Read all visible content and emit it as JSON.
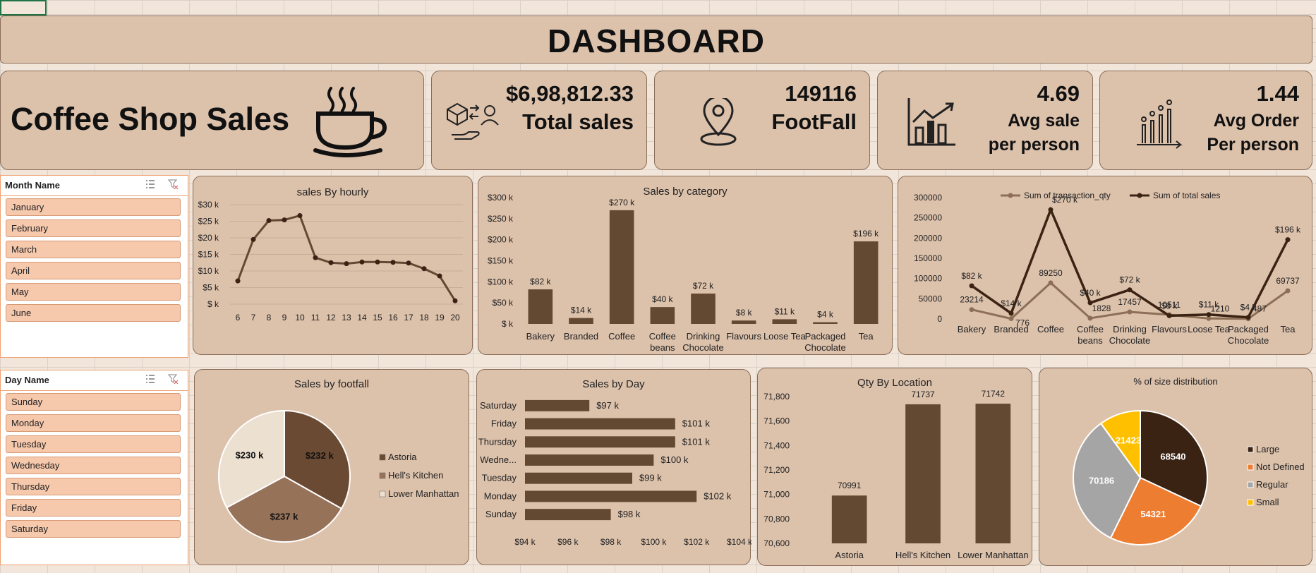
{
  "dashboard_title": "DASHBOARD",
  "kpis": {
    "shop_title": "Coffee Shop Sales",
    "total_sales_value": "$6,98,812.33",
    "total_sales_label": "Total sales",
    "footfall_value": "149116",
    "footfall_label": "FootFall",
    "avg_sale_value": "4.69",
    "avg_sale_label_1": "Avg sale",
    "avg_sale_label_2": "per person",
    "avg_order_value": "1.44",
    "avg_order_label_1": "Avg Order",
    "avg_order_label_2": "Per person"
  },
  "slicers": {
    "month": {
      "header": "Month Name",
      "items": [
        "January",
        "February",
        "March",
        "April",
        "May",
        "June"
      ]
    },
    "day": {
      "header": "Day Name",
      "items": [
        "Sunday",
        "Monday",
        "Tuesday",
        "Wednesday",
        "Thursday",
        "Friday",
        "Saturday"
      ]
    }
  },
  "colors": {
    "bar": "#634832",
    "line": "#634832",
    "panel": "#dcc1ab",
    "dark_line": "#3b2314",
    "light_line": "#8d6e57"
  },
  "chart_data": [
    {
      "id": "hourly",
      "type": "line",
      "title": "sales By hourly",
      "x": [
        6,
        7,
        8,
        9,
        10,
        11,
        12,
        13,
        14,
        15,
        16,
        17,
        18,
        19,
        20
      ],
      "values": [
        7000,
        19500,
        25200,
        25400,
        26700,
        14000,
        12500,
        12200,
        12700,
        12700,
        12600,
        12400,
        10700,
        8500,
        1000
      ],
      "yticks": [
        "$30 k",
        "$25 k",
        "$20 k",
        "$15 k",
        "$10 k",
        "$5 k",
        "$ k"
      ],
      "ylim": [
        0,
        30000
      ],
      "grid": true
    },
    {
      "id": "category",
      "type": "bar",
      "title": "Sales by category",
      "categories": [
        "Bakery",
        "Branded",
        "Coffee",
        "Coffee beans",
        "Drinking Chocolate",
        "Flavours",
        "Loose Tea",
        "Packaged Chocolate",
        "Tea"
      ],
      "values": [
        82000,
        14000,
        270000,
        40000,
        72000,
        8000,
        11000,
        4000,
        196000
      ],
      "data_labels": [
        "$82 k",
        "$14 k",
        "$270 k",
        "$40 k",
        "$72 k",
        "$8 k",
        "$11 k",
        "$4 k",
        "$196 k"
      ],
      "yticks": [
        "$300 k",
        "$250 k",
        "$200 k",
        "$150 k",
        "$100 k",
        "$50 k",
        "$ k"
      ],
      "ylim": [
        0,
        300000
      ]
    },
    {
      "id": "combo",
      "type": "line",
      "categories": [
        "Bakery",
        "Branded",
        "Coffee",
        "Coffee beans",
        "Drinking Chocolate",
        "Flavours",
        "Loose Tea",
        "Packaged Chocolate",
        "Tea"
      ],
      "yticks": [
        "300000",
        "250000",
        "200000",
        "150000",
        "100000",
        "50000",
        "0"
      ],
      "ylim": [
        0,
        300000
      ],
      "legend_position": "top",
      "series": [
        {
          "name": "Sum of transaction_qty",
          "values": [
            23214,
            776,
            89250,
            1828,
            17457,
            10511,
            1210,
            487,
            69737
          ],
          "labels": [
            "23214",
            "776",
            "89250",
            "1828",
            "17457",
            "10511",
            "1210",
            "487",
            "69737"
          ]
        },
        {
          "name": "Sum of total sales",
          "values": [
            82000,
            14000,
            270000,
            40000,
            72000,
            8000,
            11000,
            4000,
            196000
          ],
          "labels": [
            "$82 k",
            "$14 k",
            "$270 k",
            "$40 k",
            "$72 k",
            "$8 k",
            "$11 k",
            "$4 k",
            "$196 k"
          ]
        }
      ]
    },
    {
      "id": "footfall",
      "type": "pie",
      "title": "Sales by footfall",
      "categories": [
        "Astoria",
        "Hell's Kitchen",
        "Lower Manhattan"
      ],
      "values": [
        232000,
        237000,
        230000
      ],
      "labels": [
        "$232 k",
        "$237 k",
        "$230 k"
      ],
      "colors": [
        "#6b4a33",
        "#967259",
        "#ece0d1"
      ],
      "legend_position": "right"
    },
    {
      "id": "day",
      "type": "bar",
      "title": "Sales by Day",
      "categories": [
        "Saturday",
        "Friday",
        "Thursday",
        "Wedne...",
        "Tuesday",
        "Monday",
        "Sunday"
      ],
      "values": [
        97000,
        101000,
        101000,
        100000,
        99000,
        102000,
        98000
      ],
      "labels": [
        "$97 k",
        "$101 k",
        "$101 k",
        "$100 k",
        "$99 k",
        "$102 k",
        "$98 k"
      ],
      "xticks": [
        "$94 k",
        "$96 k",
        "$98 k",
        "$100 k",
        "$102 k",
        "$104 k"
      ],
      "xlim": [
        94000,
        104000
      ]
    },
    {
      "id": "location",
      "type": "bar",
      "title": "Qty By Location",
      "categories": [
        "Astoria",
        "Hell's Kitchen",
        "Lower Manhattan"
      ],
      "values": [
        70991,
        71737,
        71742
      ],
      "labels": [
        "70991",
        "71737",
        "71742"
      ],
      "yticks": [
        "71,800",
        "71,600",
        "71,400",
        "71,200",
        "71,000",
        "70,800",
        "70,600"
      ],
      "ylim": [
        70600,
        71800
      ]
    },
    {
      "id": "size",
      "type": "pie",
      "title": "% of size distribution",
      "categories": [
        "Large",
        "Not Defined",
        "Regular",
        "Small"
      ],
      "values": [
        68540,
        54321,
        70186,
        21423
      ],
      "labels": [
        "68540",
        "54321",
        "70186",
        "21423"
      ],
      "colors": [
        "#3b2314",
        "#ed7d31",
        "#a5a5a5",
        "#ffc000"
      ],
      "legend_position": "right"
    }
  ]
}
